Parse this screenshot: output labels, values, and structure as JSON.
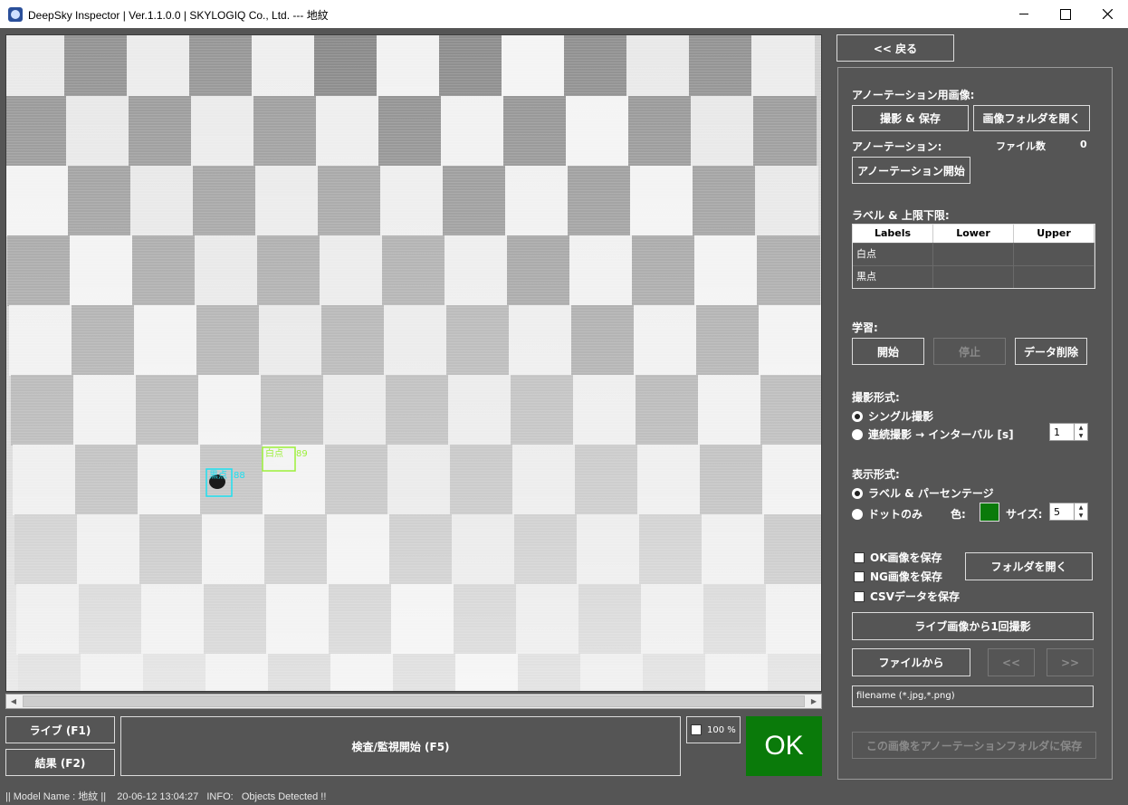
{
  "window": {
    "title": "DeepSky Inspector | Ver.1.1.0.0 | SKYLOGIQ Co., Ltd. --- 地紋"
  },
  "viewer": {
    "detections": [
      {
        "label": "黒点",
        "score": "88",
        "color": "#1ee0f0"
      },
      {
        "label": "白点",
        "score": "89",
        "color": "#9cf03a"
      }
    ]
  },
  "bottom": {
    "live_button": "ライブ (F1)",
    "result_button": "結果 (F2)",
    "inspect_button": "検査/監視開始 (F5)",
    "zoom_label": "100 %",
    "result_status": "OK"
  },
  "status_bar": "|| Model Name : 地紋 ||    20-06-12 13:04:27   INFO:   Objects Detected !!",
  "panel": {
    "back_button": "<< 戻る",
    "annotation_image_label": "アノーテーション用画像:",
    "capture_save_button": "撮影 & 保存",
    "open_image_folder_button": "画像フォルダを開く",
    "annotation_label": "アノーテーション:",
    "file_count_label": "ファイル数",
    "file_count_value": "0",
    "start_annotation_button": "アノーテーション開始",
    "label_limits_label": "ラベル & 上限下限:",
    "table": {
      "headers": [
        "Labels",
        "Lower",
        "Upper"
      ],
      "rows": [
        [
          "白点",
          "",
          ""
        ],
        [
          "黒点",
          "",
          ""
        ]
      ]
    },
    "learning_label": "学習:",
    "learn_start_button": "開始",
    "learn_stop_button": "停止",
    "delete_data_button": "データ削除",
    "capture_mode_label": "撮影形式:",
    "single_capture": "シングル撮影",
    "continuous_capture": "連続撮影 → インターバル [s]",
    "interval_value": "1",
    "display_mode_label": "表示形式:",
    "label_percentage": "ラベル & パーセンテージ",
    "dots_only": "ドットのみ",
    "color_label": "色:",
    "dot_color": "#0a7a0a",
    "size_label": "サイズ:",
    "size_value": "5",
    "save_ok": "OK画像を保存",
    "save_ng": "NG画像を保存",
    "save_csv": "CSVデータを保存",
    "open_folder_button": "フォルダを開く",
    "capture_once_button": "ライブ画像から1回撮影",
    "from_file_button": "ファイルから",
    "prev_button": "<<",
    "next_button": ">>",
    "filename_value": "filename (*.jpg,*.png)",
    "save_to_annotation_button": "この画像をアノーテーションフォルダに保存"
  }
}
